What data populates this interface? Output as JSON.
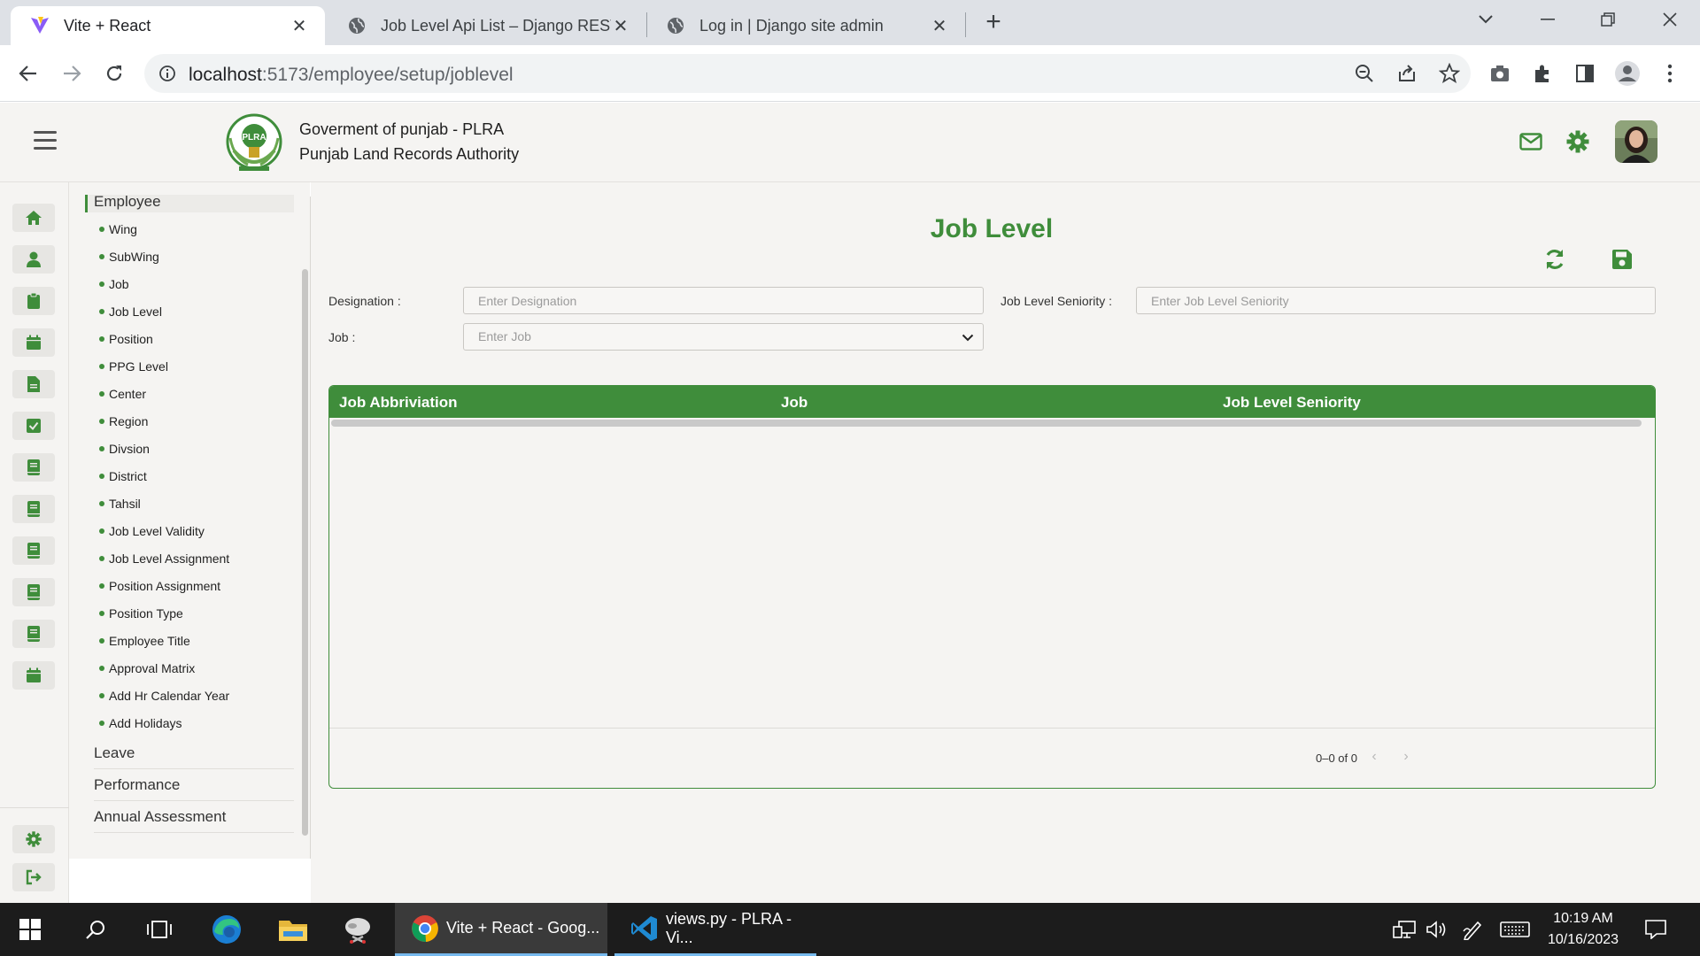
{
  "browser": {
    "tabs": [
      {
        "title": "Vite + React",
        "active": true
      },
      {
        "title": "Job Level Api List – Django REST",
        "active": false
      },
      {
        "title": "Log in | Django site admin",
        "active": false
      }
    ],
    "url_host": "localhost",
    "url_path": ":5173/employee/setup/joblevel"
  },
  "header": {
    "logo_text": "PLRA",
    "org_line1": "Goverment of punjab - PLRA",
    "org_line2": "Punjab Land Records Authority"
  },
  "sidemenu": {
    "active_section": "Employee",
    "sub_items": [
      "Wing",
      "SubWing",
      "Job",
      "Job Level",
      "Position",
      "PPG Level",
      "Center",
      "Region",
      "Divsion",
      "District",
      "Tahsil",
      "Job Level Validity",
      "Job Level Assignment",
      "Position Assignment",
      "Position Type",
      "Employee Title",
      "Approval Matrix",
      "Add Hr Calendar Year",
      "Add Holidays"
    ],
    "sections": [
      "Leave",
      "Performance",
      "Annual Assessment"
    ]
  },
  "page": {
    "title": "Job Level",
    "designation_label": "Designation :",
    "designation_placeholder": "Enter Designation",
    "seniority_label": "Job Level Seniority :",
    "seniority_placeholder": "Enter Job Level Seniority",
    "job_label": "Job :",
    "job_placeholder": "Enter Job"
  },
  "grid": {
    "columns": [
      "Job Abbriviation",
      "Job",
      "Job Level Seniority"
    ],
    "rows": [],
    "pagination": "0–0 of 0"
  },
  "taskbar": {
    "apps": [
      {
        "label": "Vite + React - Goog..."
      },
      {
        "label": "views.py - PLRA - Vi..."
      }
    ],
    "time": "10:19 AM",
    "date": "10/16/2023"
  },
  "colors": {
    "brand_green": "#3f8d3b",
    "background": "#f5f4f2"
  }
}
